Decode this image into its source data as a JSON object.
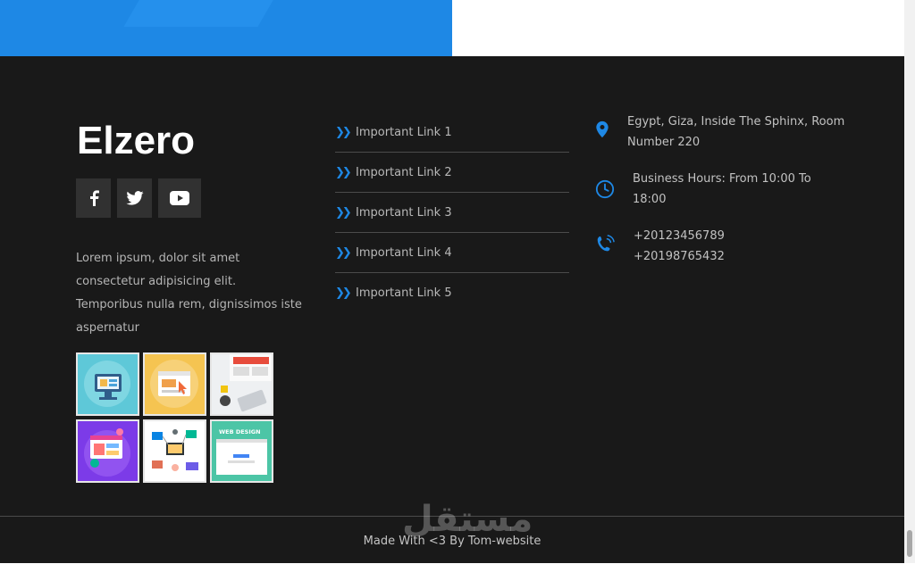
{
  "brand": {
    "name": "Elzero"
  },
  "social": [
    {
      "icon": "facebook-icon",
      "glyph": "f"
    },
    {
      "icon": "twitter-icon",
      "glyph": "t"
    },
    {
      "icon": "youtube-icon",
      "glyph": "▶"
    }
  ],
  "about": {
    "text": "Lorem ipsum, dolor sit amet consectetur adipisicing elit. Temporibus nulla rem, dignissimos iste aspernatur"
  },
  "links": [
    {
      "label": "Important Link 1"
    },
    {
      "label": "Important Link 2"
    },
    {
      "label": "Important Link 3"
    },
    {
      "label": "Important Link 4"
    },
    {
      "label": "Important Link 5"
    }
  ],
  "contact": {
    "address": {
      "line1": "Egypt, Giza, Inside The Sphinx, Room",
      "line2": "Number 220"
    },
    "hours": {
      "line1": "Business Hours: From 10:00 To",
      "line2": "18:00"
    },
    "phones": {
      "line1": "+20123456789",
      "line2": "+20198765432"
    }
  },
  "gallery": [
    {
      "icon": "monitor-illustration"
    },
    {
      "icon": "browser-cursor-illustration"
    },
    {
      "icon": "desk-workspace-photo"
    },
    {
      "icon": "purple-app-illustration"
    },
    {
      "icon": "devices-network-illustration"
    },
    {
      "icon": "web-design-illustration"
    }
  ],
  "gallery_text": {
    "web_design": "WEB DESIGN"
  },
  "footer": {
    "copyright": "Made With <3 By Tom-website"
  },
  "watermark": {
    "text": "مستقل"
  },
  "colors": {
    "accent": "#1e88e5",
    "background": "#191919",
    "tile_bg": "#313131"
  }
}
